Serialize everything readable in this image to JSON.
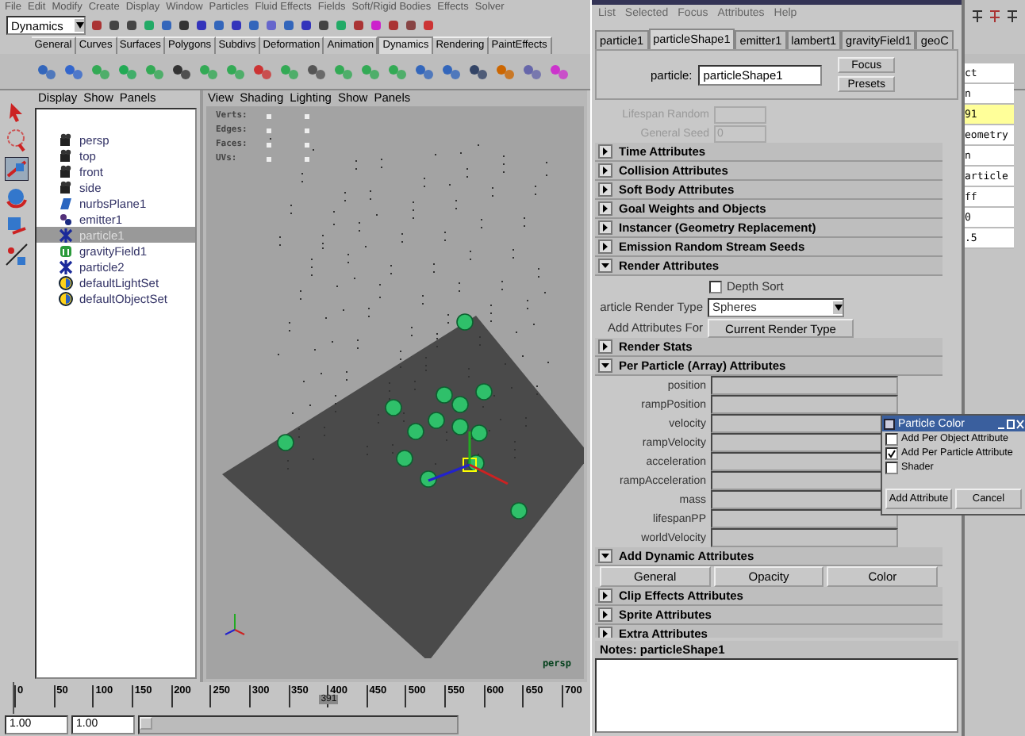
{
  "main_menu": [
    "File",
    "Edit",
    "Modify",
    "Create",
    "Display",
    "Window",
    "Particles",
    "Fluid Effects",
    "Fields",
    "Soft/Rigid Bodies",
    "Effects",
    "Solver"
  ],
  "menu_set": "Dynamics",
  "shelf_tabs": [
    {
      "label": "General",
      "selected": false
    },
    {
      "label": "Curves",
      "selected": false
    },
    {
      "label": "Surfaces",
      "selected": false
    },
    {
      "label": "Polygons",
      "selected": false
    },
    {
      "label": "Subdivs",
      "selected": false
    },
    {
      "label": "Deformation",
      "selected": false
    },
    {
      "label": "Animation",
      "selected": false
    },
    {
      "label": "Dynamics",
      "selected": true
    },
    {
      "label": "Rendering",
      "selected": false
    },
    {
      "label": "PaintEffects",
      "selected": false
    }
  ],
  "outliner": {
    "menu": [
      "Display",
      "Show",
      "Panels"
    ],
    "items": [
      {
        "label": "persp",
        "kind": "camera",
        "selected": false
      },
      {
        "label": "top",
        "kind": "camera",
        "selected": false
      },
      {
        "label": "front",
        "kind": "camera",
        "selected": false
      },
      {
        "label": "side",
        "kind": "camera",
        "selected": false
      },
      {
        "label": "nurbsPlane1",
        "kind": "plane",
        "selected": false
      },
      {
        "label": "emitter1",
        "kind": "emitter",
        "selected": false
      },
      {
        "label": "particle1",
        "kind": "particle",
        "selected": true
      },
      {
        "label": "gravityField1",
        "kind": "field",
        "selected": false
      },
      {
        "label": "particle2",
        "kind": "particle",
        "selected": false
      },
      {
        "label": "defaultLightSet",
        "kind": "set",
        "selected": false
      },
      {
        "label": "defaultObjectSet",
        "kind": "set",
        "selected": false
      }
    ]
  },
  "viewport": {
    "menu": [
      "View",
      "Shading",
      "Lighting",
      "Show",
      "Panels"
    ],
    "hud": [
      "Verts:",
      "Edges:",
      "Faces:",
      "UVs:"
    ],
    "camera": "persp"
  },
  "attribute_editor": {
    "menu": [
      "List",
      "Selected",
      "Focus",
      "Attributes",
      "Help"
    ],
    "tabs": [
      {
        "label": "particle1",
        "selected": false
      },
      {
        "label": "particleShape1",
        "selected": true
      },
      {
        "label": "emitter1",
        "selected": false
      },
      {
        "label": "lambert1",
        "selected": false
      },
      {
        "label": "gravityField1",
        "selected": false
      },
      {
        "label": "geoC",
        "selected": false
      }
    ],
    "node_label": "particle:",
    "node_name": "particleShape1",
    "buttons": [
      "Focus",
      "Presets"
    ],
    "faded_fields": [
      {
        "label": "Lifespan Random"
      },
      {
        "label": "General Seed",
        "value": "0"
      }
    ],
    "sections": [
      {
        "label": "Time Attributes",
        "expanded": false
      },
      {
        "label": "Collision Attributes",
        "expanded": false
      },
      {
        "label": "Soft Body Attributes",
        "expanded": false
      },
      {
        "label": "Goal Weights and Objects",
        "expanded": false
      },
      {
        "label": "Instancer (Geometry Replacement)",
        "expanded": false
      },
      {
        "label": "Emission Random Stream Seeds",
        "expanded": false
      },
      {
        "label": "Render Attributes",
        "expanded": true,
        "kind": "render",
        "depth_sort": {
          "label": "Depth Sort",
          "checked": false
        },
        "render_type": {
          "label": "article Render Type",
          "value": "Spheres"
        },
        "add_for": {
          "label": "Add Attributes For",
          "button": "Current Render Type"
        }
      },
      {
        "label": "Render Stats",
        "expanded": false
      },
      {
        "label": "Per Particle (Array) Attributes",
        "expanded": true,
        "kind": "attributes",
        "attributes": [
          "position",
          "rampPosition",
          "velocity",
          "rampVelocity",
          "acceleration",
          "rampAcceleration",
          "mass",
          "lifespanPP",
          "worldVelocity"
        ]
      },
      {
        "label": "Add Dynamic Attributes",
        "expanded": true,
        "kind": "buttons",
        "buttons": [
          "General",
          "Opacity",
          "Color"
        ]
      },
      {
        "label": "Clip Effects Attributes",
        "expanded": false
      },
      {
        "label": "Sprite Attributes",
        "expanded": false
      },
      {
        "label": "Extra Attributes",
        "expanded": false
      }
    ],
    "notes": "Notes: particleShape1"
  },
  "channel_box": [
    {
      "text": "ct",
      "highlighted": false
    },
    {
      "text": "n",
      "highlighted": false
    },
    {
      "text": "91",
      "highlighted": true
    },
    {
      "text": "eometry",
      "highlighted": false
    },
    {
      "text": "n",
      "highlighted": false
    },
    {
      "text": "article",
      "highlighted": false
    },
    {
      "text": "ff",
      "highlighted": false
    },
    {
      "text": "0",
      "highlighted": false
    },
    {
      "text": ".5",
      "highlighted": false
    }
  ],
  "particle_color_dialog": {
    "title": "Particle Color",
    "options": [
      {
        "label": "Add Per Object Attribute",
        "checked": false
      },
      {
        "label": "Add Per Particle Attribute",
        "checked": true
      },
      {
        "label": "Shader",
        "checked": false
      }
    ],
    "buttons": [
      "Add Attribute",
      "Cancel"
    ]
  },
  "timeline": {
    "ticks": [
      "0",
      "50",
      "100",
      "150",
      "200",
      "250",
      "300",
      "350",
      "400",
      "450",
      "500",
      "550",
      "600",
      "650",
      "700"
    ],
    "current_frame": "391",
    "range_start": "1.00",
    "range_end": "1.00",
    "range_slider": {
      "level": 0.02
    }
  }
}
